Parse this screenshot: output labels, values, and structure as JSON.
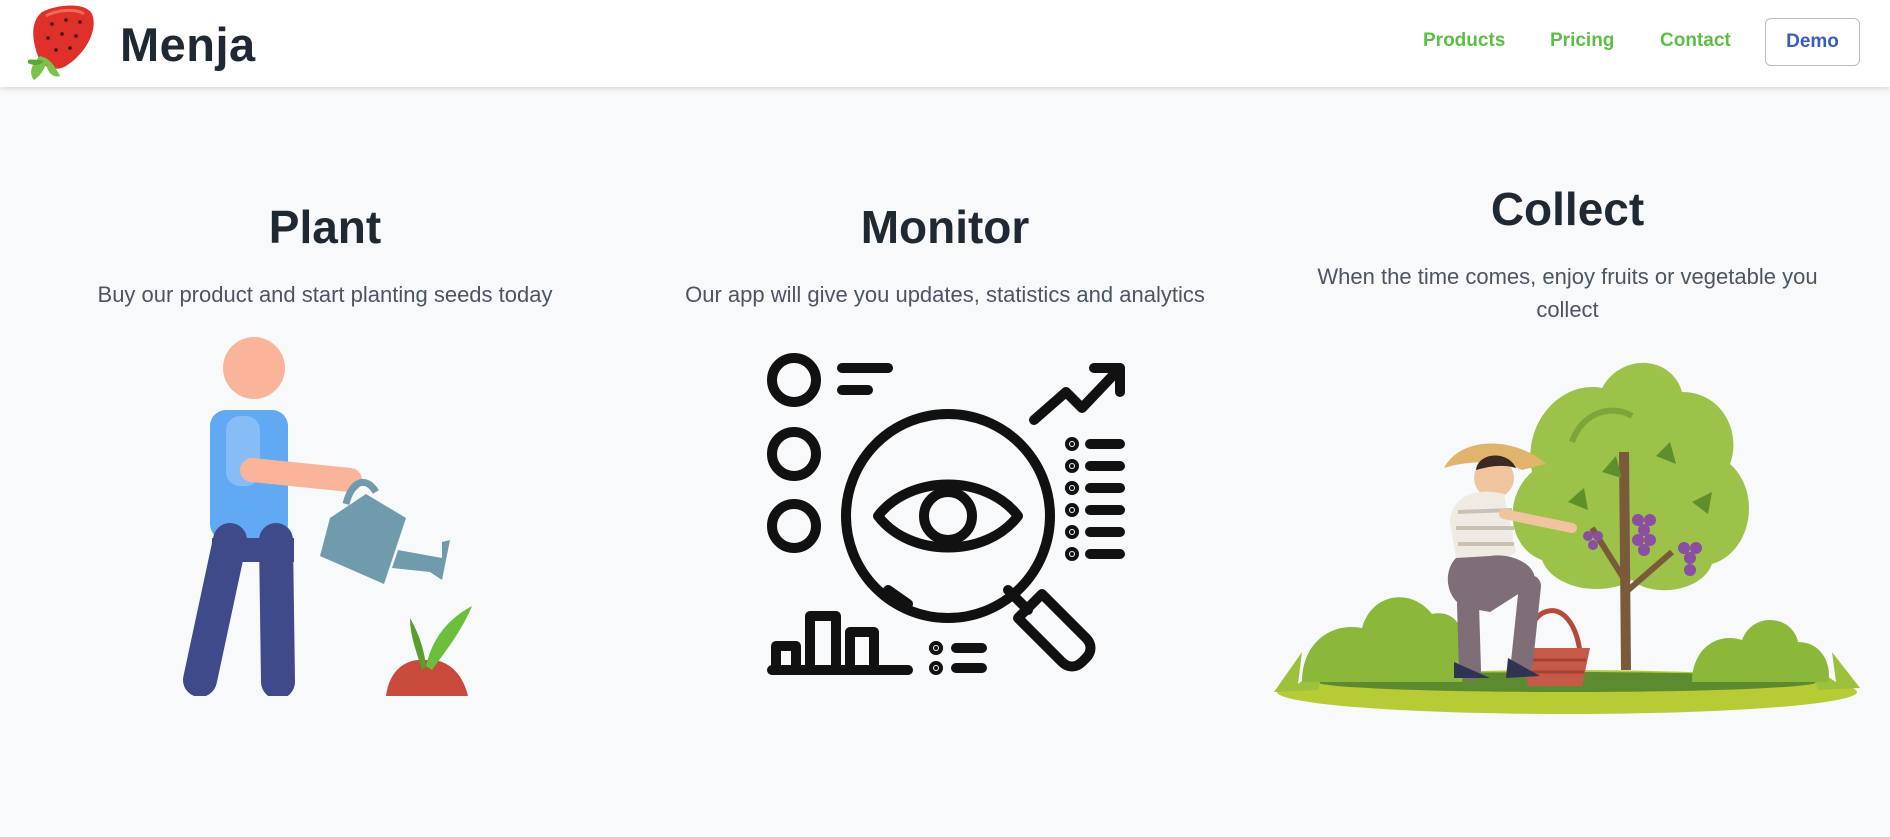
{
  "navbar": {
    "brand_name": "Menja",
    "logo_icon": "strawberry-icon",
    "links": [
      {
        "label": "Products"
      },
      {
        "label": "Pricing"
      },
      {
        "label": "Contact"
      }
    ],
    "demo_label": "Demo"
  },
  "colors": {
    "link_green": "#5cbf45",
    "demo_blue": "#3b5bc2",
    "heading": "#1f2933",
    "body_text": "#4b5563",
    "background": "#f8f9fa"
  },
  "features": [
    {
      "title": "Plant",
      "description": "Buy our product and start planting seeds today",
      "illustration": "watering-plant-illustration"
    },
    {
      "title": "Monitor",
      "description": "Our app will give you updates, statistics and analytics",
      "illustration": "analytics-magnifier-icon"
    },
    {
      "title": "Collect",
      "description_line1": "When the time comes, enjoy fruits or vegetable you",
      "description_line2": "collect",
      "illustration": "harvest-grapes-illustration"
    }
  ]
}
